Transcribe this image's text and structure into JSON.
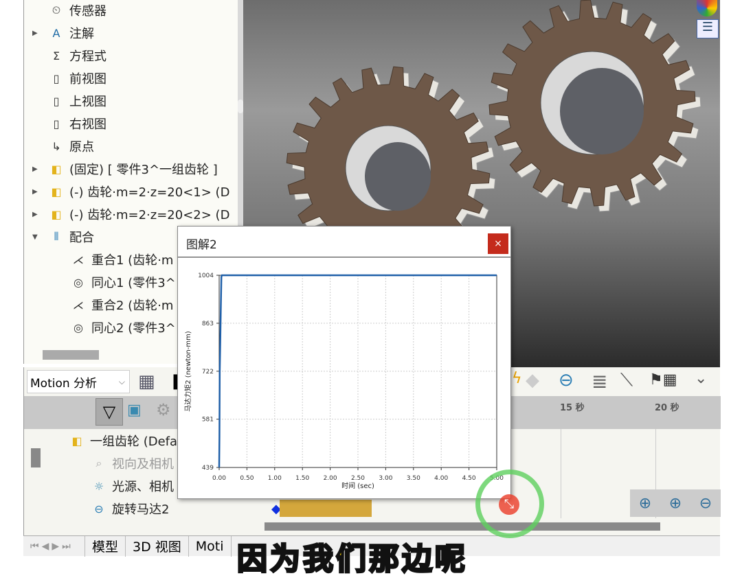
{
  "tree": {
    "items": [
      {
        "label": "传感器",
        "icon": "sensor-folder-icon"
      },
      {
        "label": "注解",
        "icon": "annotation-folder-icon",
        "expander": "collapsed"
      },
      {
        "label": "方程式",
        "icon": "equation-folder-icon"
      },
      {
        "label": "前视图",
        "icon": "plane-icon"
      },
      {
        "label": "上视图",
        "icon": "plane-icon"
      },
      {
        "label": "右视图",
        "icon": "plane-icon"
      },
      {
        "label": "原点",
        "icon": "origin-icon"
      },
      {
        "label": "(固定) [ 零件3^一组齿轮 ]",
        "icon": "part-icon",
        "expander": "collapsed"
      },
      {
        "label": "(-) 齿轮·m=2·z=20<1> (D",
        "icon": "part-icon",
        "expander": "collapsed"
      },
      {
        "label": "(-) 齿轮·m=2·z=20<2> (D",
        "icon": "part-icon",
        "expander": "collapsed"
      },
      {
        "label": "配合",
        "icon": "mates-icon",
        "expander": "expanded"
      },
      {
        "label": "重合1 (齿轮·m",
        "icon": "coincident-icon",
        "indent": true
      },
      {
        "label": "同心1 (零件3^",
        "icon": "concentric-icon",
        "indent": true
      },
      {
        "label": "重合2 (齿轮·m",
        "icon": "coincident-icon",
        "indent": true
      },
      {
        "label": "同心2 (零件3^",
        "icon": "concentric-icon",
        "indent": true
      }
    ]
  },
  "motion": {
    "study_type": "Motion 分析",
    "timeline": [
      "15 秒",
      "20 秒"
    ],
    "tree": [
      {
        "label": "一组齿轮 (Defa",
        "icon": "assembly-icon"
      },
      {
        "label": "视向及相机",
        "icon": "camera-icon",
        "disabled": true
      },
      {
        "label": "光源、相机",
        "icon": "lights-folder-icon"
      },
      {
        "label": "旋转马达2",
        "icon": "rotary-motor-icon"
      }
    ]
  },
  "tabs": [
    "模型",
    "3D 视图",
    "Moti"
  ],
  "dialog": {
    "title": "图解2",
    "close": "×"
  },
  "chart_data": {
    "type": "line",
    "xlabel": "时间 (sec)",
    "ylabel": "马达力矩2 (newton-mm)",
    "xlim": [
      0,
      5
    ],
    "ylim": [
      439,
      1004
    ],
    "xticks": [
      "0.00",
      "0.50",
      "1.00",
      "1.50",
      "2.00",
      "2.50",
      "3.00",
      "3.50",
      "4.00",
      "4.50",
      "5.00"
    ],
    "yticks": [
      "439",
      "581",
      "722",
      "863",
      "1004"
    ],
    "grid": true,
    "color": "#1f5fa8",
    "series": [
      {
        "x": [
          0,
          0.005,
          0.01,
          0.02,
          0.03,
          0.04,
          0.05,
          1,
          2,
          3,
          4,
          5
        ],
        "y": [
          439,
          530,
          720,
          810,
          910,
          1000,
          1004,
          1004,
          1004,
          1004,
          1004,
          1004
        ]
      }
    ]
  },
  "subtitle": "因为我们那边呢"
}
